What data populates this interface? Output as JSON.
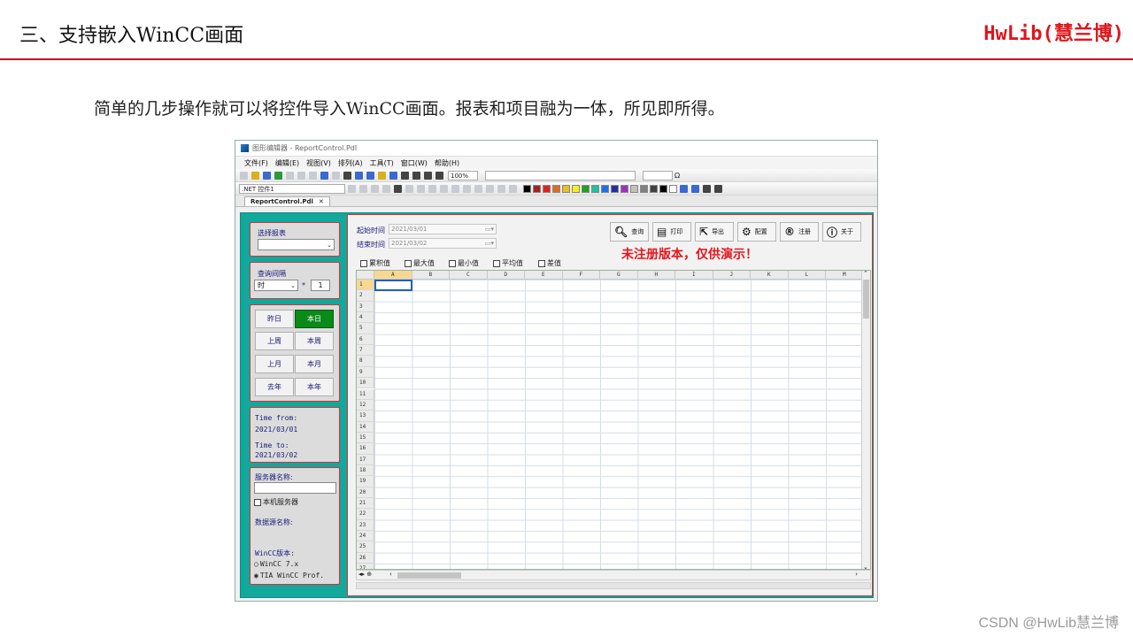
{
  "slide": {
    "title": "三、支持嵌入WinCC画面",
    "brand": "HwLib(慧兰博)",
    "description": "简单的几步操作就可以将控件导入WinCC画面。报表和项目融为一体，所见即所得。",
    "credit": "CSDN @HwLib慧兰博"
  },
  "window": {
    "title": "图形编辑器 - ReportControl.Pdl",
    "menu": [
      "文件(F)",
      "编辑(E)",
      "视图(V)",
      "排列(A)",
      "工具(T)",
      "窗口(W)",
      "帮助(H)"
    ],
    "zoom": "100%",
    "object_select": ".NET 控件1",
    "tab_label": "ReportControl.Pdl",
    "tab_close": "✕"
  },
  "left": {
    "report_label": "选择报表",
    "interval_label": "查询间隔",
    "interval_unit": "时",
    "interval_multiply": "*",
    "interval_value": "1",
    "quick_buttons": [
      {
        "label": "昨日",
        "active": false
      },
      {
        "label": "本日",
        "active": true
      },
      {
        "label": "上周",
        "active": false
      },
      {
        "label": "本周",
        "active": false
      },
      {
        "label": "上月",
        "active": false
      },
      {
        "label": "本月",
        "active": false
      },
      {
        "label": "去年",
        "active": false
      },
      {
        "label": "本年",
        "active": false
      }
    ],
    "time_from_label": "Time from:",
    "time_from_value": "2021/03/01",
    "time_to_label": "Time to:",
    "time_to_value": "2021/03/02",
    "server_label": "服务器名称:",
    "local_server_label": "本机服务器",
    "datasource_label": "数据源名称:",
    "wincc_version_label": "WinCC版本:",
    "wincc_options": [
      {
        "label": "WinCC 7.x",
        "selected": false
      },
      {
        "label": "TIA WinCC Prof.",
        "selected": true
      }
    ]
  },
  "main": {
    "start_label": "起始时间",
    "start_value": "2021/03/01",
    "end_label": "结束时间",
    "end_value": "2021/03/02",
    "checkboxes": [
      "累积值",
      "最大值",
      "最小值",
      "平均值",
      "差值"
    ],
    "actions": [
      {
        "label": "查询",
        "icon": "search-icon"
      },
      {
        "label": "打印",
        "icon": "printer-icon"
      },
      {
        "label": "导出",
        "icon": "export-icon"
      },
      {
        "label": "配置",
        "icon": "gear-icon"
      },
      {
        "label": "注册",
        "icon": "registered-icon"
      },
      {
        "label": "关于",
        "icon": "info-icon"
      }
    ],
    "warning": "未注册版本，仅供演示！",
    "columns": [
      "A",
      "B",
      "C",
      "D",
      "E",
      "F",
      "G",
      "H",
      "I",
      "J",
      "K",
      "L",
      "M"
    ],
    "rows": [
      "1",
      "2",
      "3",
      "4",
      "5",
      "6",
      "7",
      "8",
      "9",
      "10",
      "11",
      "12",
      "13",
      "14",
      "15",
      "16",
      "17",
      "18",
      "19",
      "20",
      "21",
      "22",
      "23",
      "24",
      "25",
      "26",
      "27"
    ],
    "selected_cell": "A1"
  }
}
